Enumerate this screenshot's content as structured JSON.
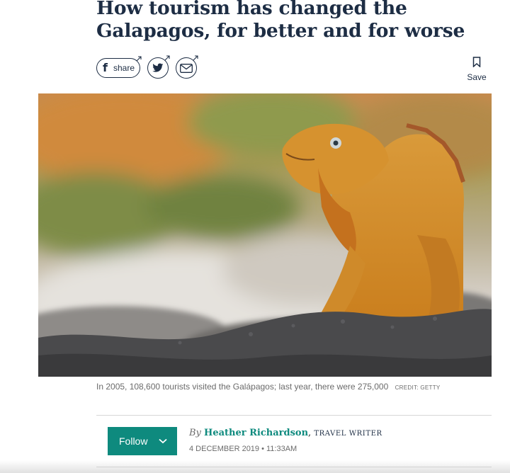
{
  "article": {
    "headline": "How tourism has changed the Galapagos, for better and for worse"
  },
  "share": {
    "facebook_label": "share",
    "icons": [
      "facebook-icon",
      "twitter-icon",
      "email-icon",
      "external-link-icon"
    ]
  },
  "save": {
    "label": "Save",
    "icon": "bookmark-icon"
  },
  "image": {
    "caption": "In 2005, 108,600 tourists visited the Galápagos; last year, there were 275,000",
    "credit": "CREDIT: GETTY"
  },
  "author": {
    "follow_label": "Follow",
    "by": "By",
    "name": "Heather Richardson",
    "role": "TRAVEL WRITER",
    "date": "4 DECEMBER 2019 • 11:33AM"
  },
  "colors": {
    "navy": "#1d2d44",
    "accent": "#0e8a7e"
  }
}
